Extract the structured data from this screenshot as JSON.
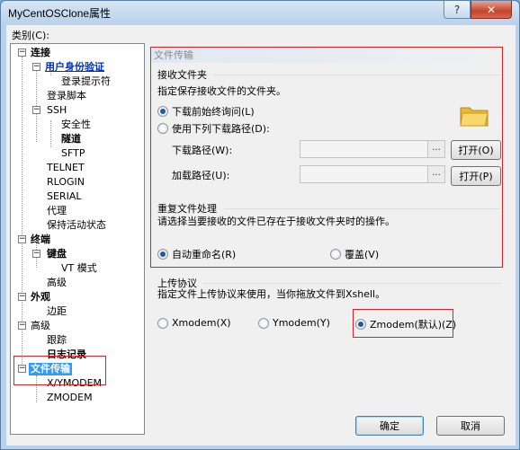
{
  "window": {
    "title": "MyCentOSClone属性",
    "help_glyph": "?",
    "close_glyph": "✕"
  },
  "category_label": "类别(C):",
  "tree": {
    "connection": "连接",
    "user_auth": "用户身份验证",
    "login_prompt": "登录提示符",
    "login_script": "登录脚本",
    "ssh": "SSH",
    "security": "安全性",
    "tunnel": "隧道",
    "sftp": "SFTP",
    "telnet": "TELNET",
    "rlogin": "RLOGIN",
    "serial": "SERIAL",
    "proxy": "代理",
    "keepalive": "保持活动状态",
    "terminal": "终端",
    "keyboard": "键盘",
    "vt_mode": "VT 模式",
    "term_advanced": "高级",
    "appearance": "外观",
    "margin": "边距",
    "advanced": "高级",
    "trace": "跟踪",
    "log": "日志记录",
    "file_transfer": "文件传输",
    "xymodem": "X/YMODEM",
    "zmodem": "ZMODEM",
    "expander_glyph": "−"
  },
  "file_transfer": {
    "section_title": "文件传输",
    "receive_folder_label": "接收文件夹",
    "receive_folder_desc": "指定保存接收文件的文件夹。",
    "radio_start_dir": "下载前始终询问(L)",
    "radio_use_path": "使用下列下载路径(D):",
    "download_path_label": "下载路径(W):",
    "upload_path_label": "加载路径(U):",
    "browse_glyph": "...",
    "open_o": "打开(O)",
    "open_p": "打开(P)",
    "duplicate_label": "重复文件处理",
    "duplicate_desc": "请选择当要接收的文件已存在于接收文件夹时的操作。",
    "radio_rename": "自动重命名(R)",
    "radio_overwrite": "覆盖(V)"
  },
  "upload_protocol": {
    "label": "上传协议",
    "desc": "指定文件上传协议来使用，当你拖放文件到Xshell。",
    "xmodem": "Xmodem(X)",
    "ymodem": "Ymodem(Y)",
    "zmodem": "Zmodem(默认)(Z)"
  },
  "buttons": {
    "ok": "确定",
    "cancel": "取消"
  },
  "colors": {
    "highlight_box": "#e02020",
    "selection": "#3399ff"
  }
}
